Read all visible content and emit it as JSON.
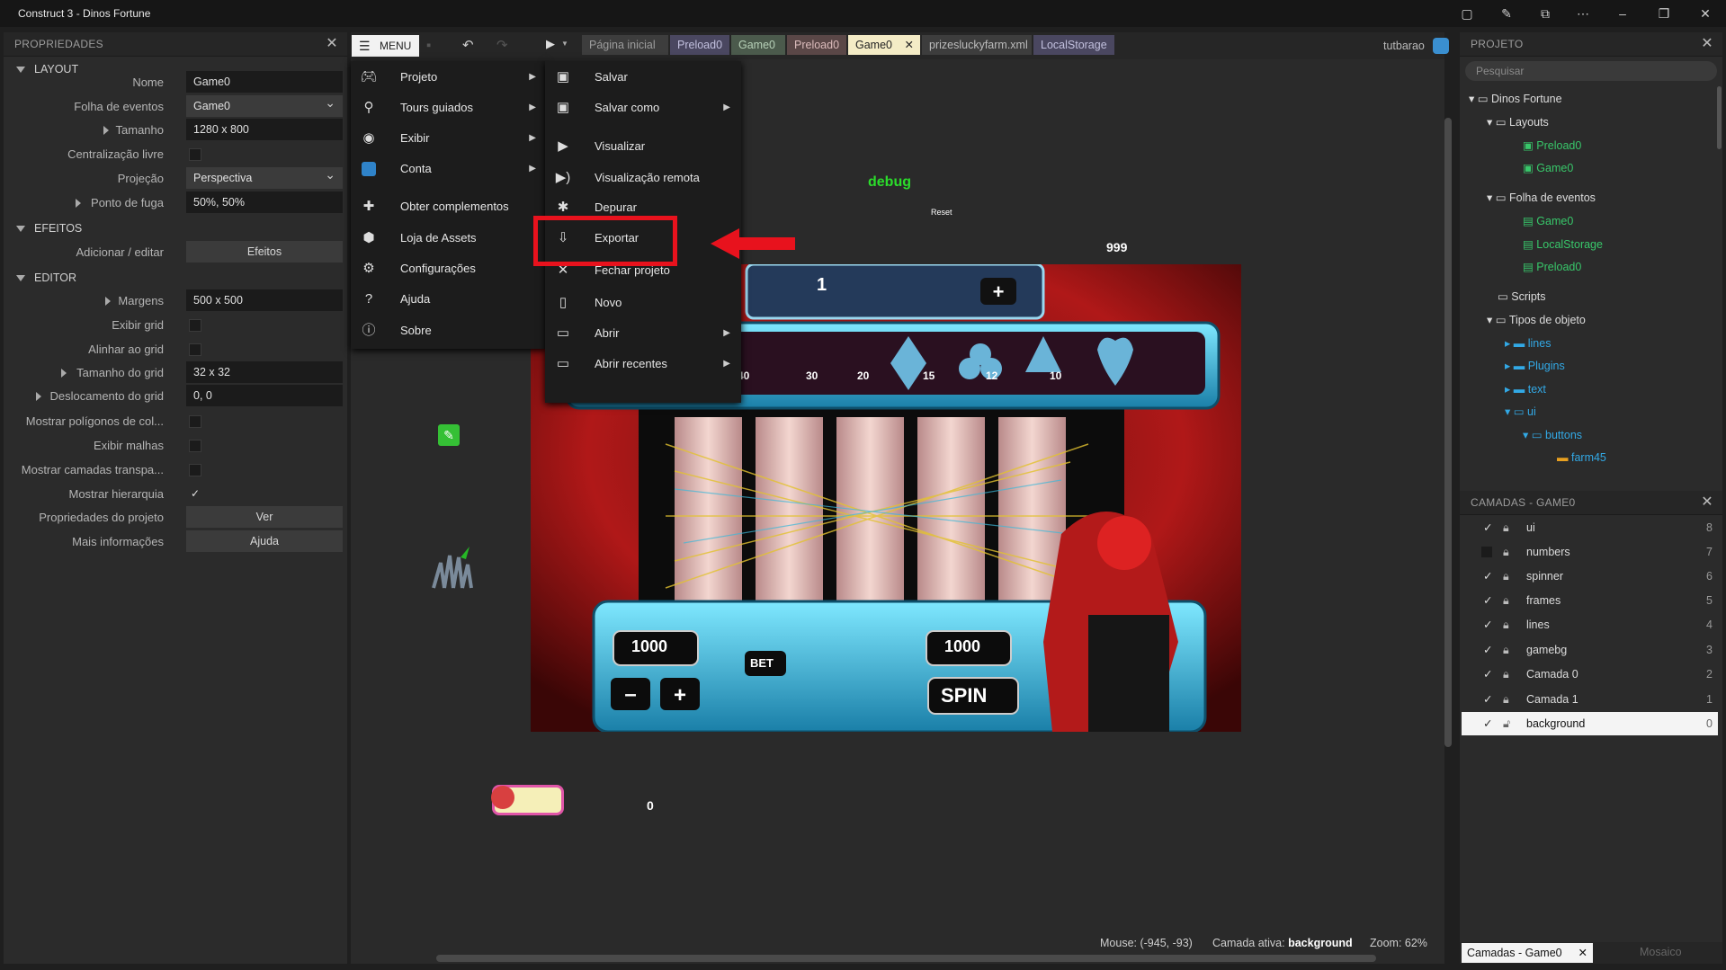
{
  "window": {
    "title": "Construct 3 - Dinos Fortune"
  },
  "properties": {
    "header": "PROPRIEDADES",
    "sections": {
      "layout": "LAYOUT",
      "effects": "EFEITOS",
      "editor": "EDITOR"
    },
    "rows": {
      "name": {
        "label": "Nome",
        "value": "Game0"
      },
      "eventsheet": {
        "label": "Folha de eventos",
        "value": "Game0"
      },
      "size": {
        "label": "Tamanho",
        "value": "1280 x 800"
      },
      "unbounded": {
        "label": "Centralização livre"
      },
      "projection": {
        "label": "Projeção",
        "value": "Perspectiva"
      },
      "vanishing": {
        "label": "Ponto de fuga",
        "value": "50%, 50%"
      },
      "effects": {
        "label": "Adicionar / editar",
        "value": "Efeitos"
      },
      "margins": {
        "label": "Margens",
        "value": "500 x 500"
      },
      "showgrid": {
        "label": "Exibir grid"
      },
      "snapgrid": {
        "label": "Alinhar ao grid"
      },
      "gridsize": {
        "label": "Tamanho do grid",
        "value": "32 x 32"
      },
      "gridoffset": {
        "label": "Deslocamento do grid",
        "value": "0, 0"
      },
      "collision": {
        "label": "Mostrar polígonos de col..."
      },
      "meshes": {
        "label": "Exibir malhas"
      },
      "translayers": {
        "label": "Mostrar camadas transpa..."
      },
      "hierarchy": {
        "label": "Mostrar hierarquia"
      },
      "projprops": {
        "label": "Propriedades do projeto",
        "value": "Ver"
      },
      "moreinfo": {
        "label": "Mais informações",
        "value": "Ajuda"
      }
    }
  },
  "toolbar": {
    "menu_label": "MENU",
    "tabs": [
      "Página inicial",
      "Preload0",
      "Game0",
      "Preload0",
      "Game0",
      "prizesluckyfarm.xml",
      "LocalStorage"
    ],
    "user": "tutbarao"
  },
  "mainmenu": {
    "items": [
      "Projeto",
      "Tours guiados",
      "Exibir",
      "Conta",
      "Obter complementos",
      "Loja de Assets",
      "Configurações",
      "Ajuda",
      "Sobre"
    ]
  },
  "submenu": {
    "items": [
      "Salvar",
      "Salvar como",
      "Visualizar",
      "Visualização remota",
      "Depurar",
      "Exportar",
      "Fechar projeto",
      "Novo",
      "Abrir",
      "Abrir recentes"
    ]
  },
  "canvas": {
    "debug": "debug",
    "reset": "Reset",
    "counter": "999",
    "zero": "0",
    "lines_value": "1",
    "bet_value": "1000",
    "win_value": "1000",
    "bet_label": "BET",
    "spin_label": "SPIN",
    "paytable": [
      "40",
      "30",
      "20",
      "15",
      "12",
      "10"
    ]
  },
  "status": {
    "mouse": "Mouse: (-945, -93)",
    "layer_prefix": "Camada ativa: ",
    "layer": "background",
    "zoom": "Zoom: 62%"
  },
  "project": {
    "header": "PROJETO",
    "search_placeholder": "Pesquisar",
    "tree": {
      "root": "Dinos Fortune",
      "layouts": "Layouts",
      "layout_items": [
        "Preload0",
        "Game0"
      ],
      "eventsheets": "Folha de eventos",
      "eventsheet_items": [
        "Game0",
        "LocalStorage",
        "Preload0"
      ],
      "scripts": "Scripts",
      "objecttypes": "Tipos de objeto",
      "obj_items": [
        "lines",
        "Plugins",
        "text",
        "ui"
      ],
      "buttons": "buttons",
      "farm": "farm45"
    }
  },
  "layers": {
    "header": "CAMADAS - GAME0",
    "rows": [
      {
        "name": "ui",
        "num": "8"
      },
      {
        "name": "numbers",
        "num": "7"
      },
      {
        "name": "spinner",
        "num": "6"
      },
      {
        "name": "frames",
        "num": "5"
      },
      {
        "name": "lines",
        "num": "4"
      },
      {
        "name": "gamebg",
        "num": "3"
      },
      {
        "name": "Camada 0",
        "num": "2"
      },
      {
        "name": "Camada 1",
        "num": "1"
      },
      {
        "name": "background",
        "num": "0"
      }
    ],
    "bottom_tabs": [
      "Camadas - Game0",
      "Mosaico"
    ]
  }
}
